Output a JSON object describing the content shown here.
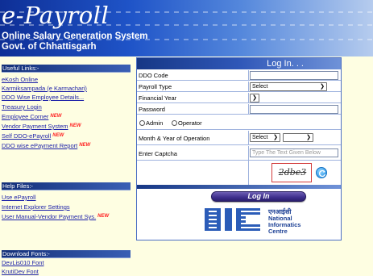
{
  "header": {
    "title": "e-Payroll",
    "subtitle": "Online Salary Generation System",
    "govt": "Govt. of Chhattisgarh"
  },
  "sidebar": {
    "useful_links_heading": "Useful Links:-",
    "useful_links": [
      {
        "label": "eKosh Online",
        "new": false
      },
      {
        "label": "Karmiksampada (e Karmachari)",
        "new": false
      },
      {
        "label": "DDO Wise Employee Details...",
        "new": false
      },
      {
        "label": "Treasury Login",
        "new": false
      },
      {
        "label": "Employee Corner",
        "new": true
      },
      {
        "label": "Vendor Payment System",
        "new": true
      },
      {
        "label": "Self DDO-ePayroll",
        "new": true
      },
      {
        "label": "DDO wise ePayment Report",
        "new": true
      }
    ],
    "help_heading": "Help Files:-",
    "help_links": [
      {
        "label": "Use ePayroll",
        "new": false
      },
      {
        "label": "Internet Explorer Settings",
        "new": false
      },
      {
        "label": "User Manual-Vendor Payment Sys.",
        "new": true
      }
    ],
    "download_heading": "Download Fonts:-",
    "download_links": [
      {
        "label": "DevLis010 Font",
        "new": false
      },
      {
        "label": "KrutiDev Font",
        "new": false
      }
    ],
    "new_badge": "NEW"
  },
  "login": {
    "title": "Log In. . .",
    "ddo_code_label": "DDO Code",
    "ddo_code_value": "",
    "payroll_type_label": "Payroll Type",
    "payroll_type_value": "Select",
    "financial_year_label": "Financial Year",
    "financial_year_value": "",
    "password_label": "Password",
    "password_value": "",
    "radio_admin": "Admin",
    "radio_operator": "Operator",
    "month_year_label": "Month & Year of Operation",
    "month_value": "Select",
    "year_value": "",
    "captcha_label": "Enter Captcha",
    "captcha_placeholder": "Type The Text Given Below",
    "captcha_text": "2dbe3",
    "button_label": "Log In"
  },
  "nic": {
    "hindi": "एनआईसी",
    "line1": "National",
    "line2": "Informatics",
    "line3": "Centre"
  },
  "colors": {
    "page_bg": "#fefee2",
    "header_blue": "#1f54c8",
    "link_blue": "#1b1fa8",
    "new_red": "#ff2020",
    "button_purple": "#3e2f8c"
  }
}
